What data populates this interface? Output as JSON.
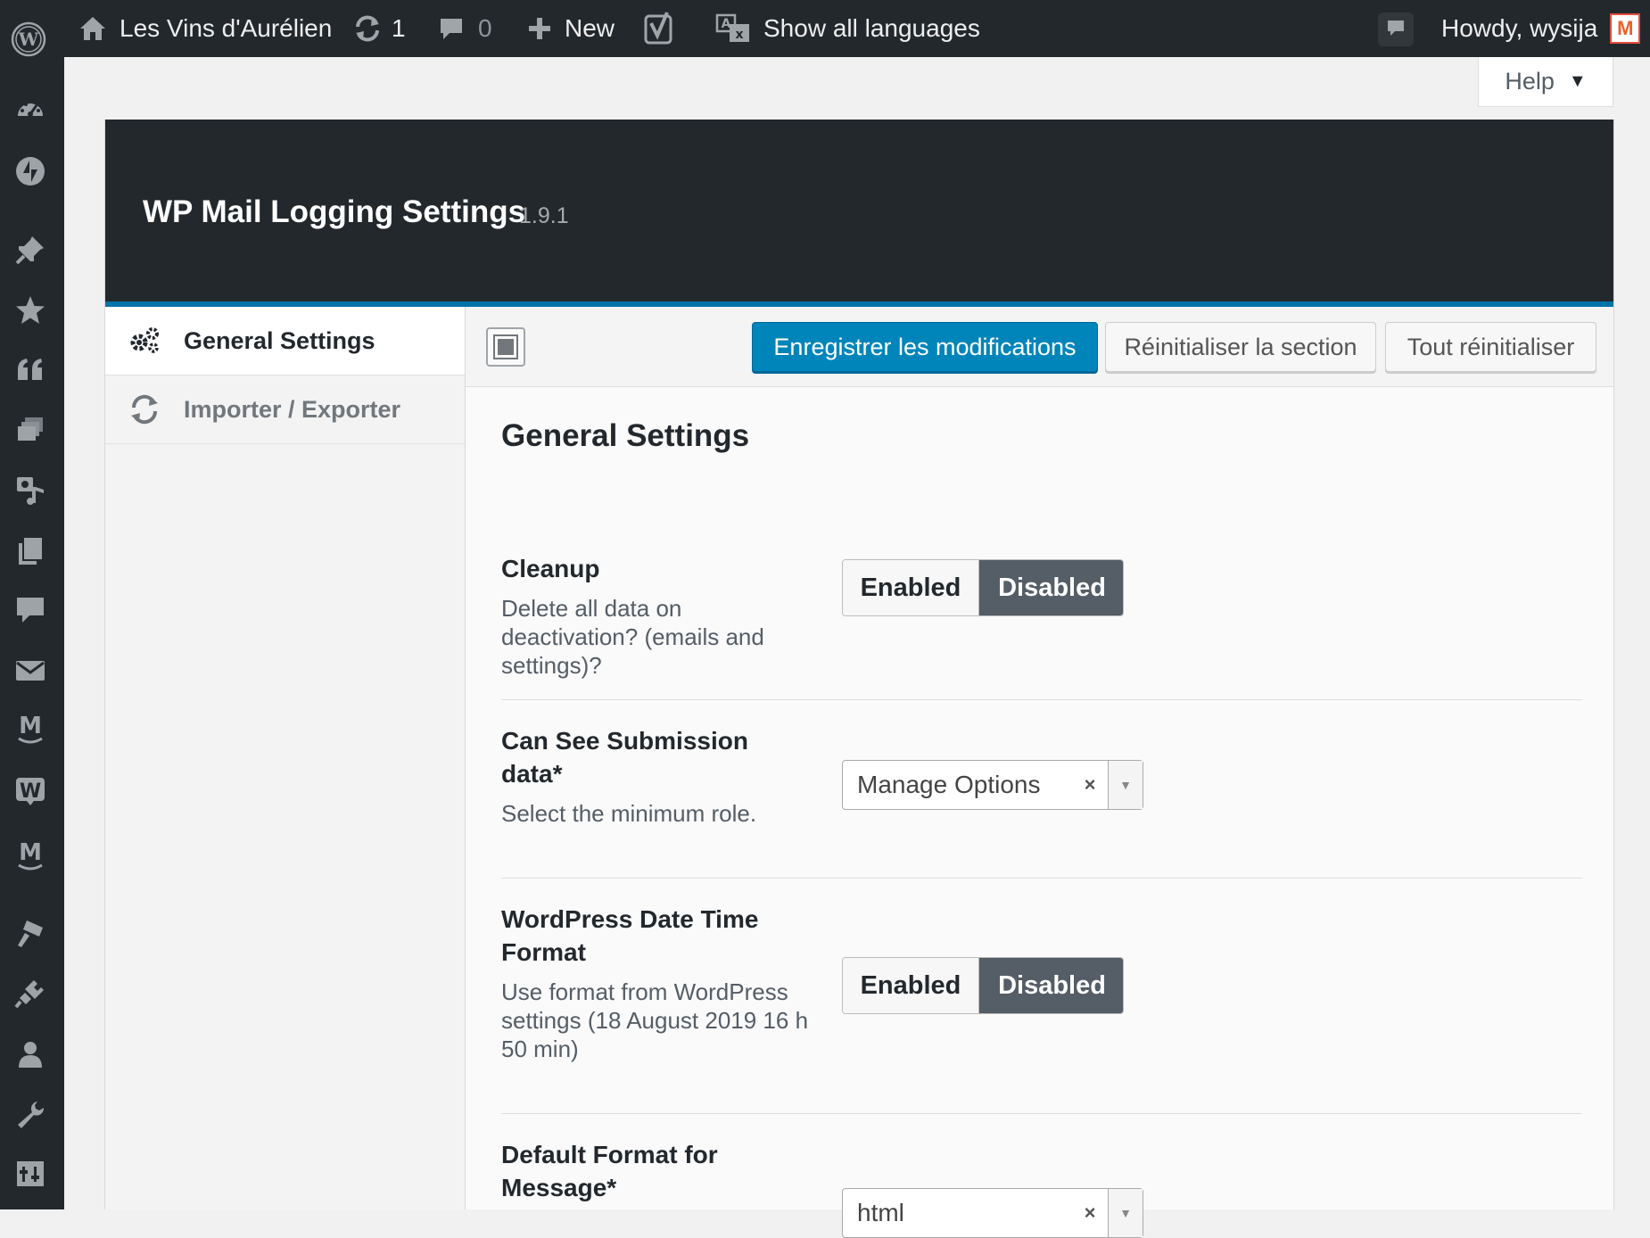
{
  "admin_bar": {
    "site_name": "Les Vins d'Aurélien",
    "updates_count": "1",
    "comments_count": "0",
    "new_label": "New",
    "languages_label": "Show all languages",
    "howdy": "Howdy, wysija",
    "avatar_letter": "M"
  },
  "help": {
    "label": "Help"
  },
  "side_menu_icons": [
    "dashboard-icon",
    "jetpack-icon",
    "pin-icon",
    "star-icon",
    "quote-icon",
    "layers-icon",
    "media-icon",
    "pages-icon",
    "comments-icon",
    "mail-icon",
    "mailpoet-icon",
    "woocommerce-icon",
    "mailpoet-icon",
    "appearance-icon",
    "plugins-icon",
    "users-icon",
    "tools-icon",
    "settings-icon"
  ],
  "plugin": {
    "title": "WP Mail Logging Settings",
    "version": "1.9.1"
  },
  "tabs": [
    {
      "label": "General Settings",
      "icon": "gears-icon",
      "active": true
    },
    {
      "label": "Importer / Exporter",
      "icon": "refresh-icon",
      "active": false
    }
  ],
  "toolbar": {
    "save_label": "Enregistrer les modifications",
    "reset_section_label": "Réinitialiser la section",
    "reset_all_label": "Tout réinitialiser"
  },
  "section": {
    "title": "General Settings",
    "fields": [
      {
        "title": "Cleanup",
        "description": "Delete all data on deactivation? (emails and settings)?",
        "type": "toggle",
        "on_label": "Enabled",
        "off_label": "Disabled",
        "selected": "Disabled"
      },
      {
        "title": "Can See Submission data*",
        "description": "Select the minimum role.",
        "type": "select",
        "value": "Manage Options"
      },
      {
        "title": "WordPress Date Time Format",
        "description": "Use format from WordPress settings (18 August 2019 16 h 50 min)",
        "type": "toggle",
        "on_label": "Enabled",
        "off_label": "Disabled",
        "selected": "Disabled"
      },
      {
        "title": "Default Format for Message*",
        "type": "select",
        "value": "html"
      }
    ]
  },
  "colors": {
    "admin_bar": "#23282d",
    "accent": "#0073aa",
    "primary_button": "#0085ba",
    "toggle_selected": "#555d66"
  }
}
